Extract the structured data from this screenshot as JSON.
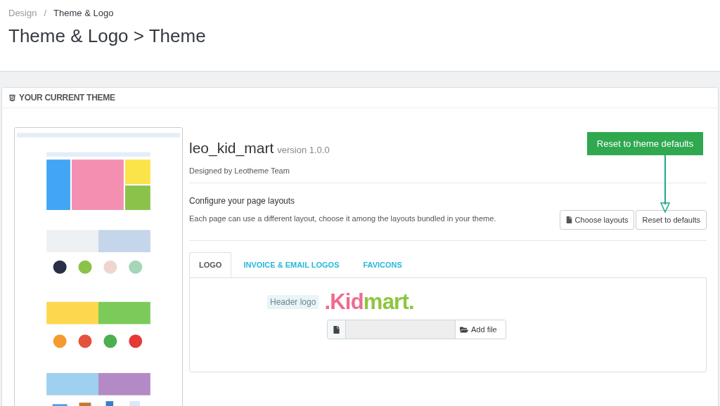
{
  "breadcrumb": [
    {
      "label": "Design",
      "current": false
    },
    {
      "label": "Theme & Logo",
      "current": true
    }
  ],
  "breadcrumb_separator": "/",
  "page_title": "Theme & Logo > Theme",
  "panel": {
    "title": "YOUR CURRENT THEME",
    "theme": {
      "name": "leo_kid_mart",
      "version": "version 1.0.0",
      "author": "Designed by Leotheme Team"
    },
    "layouts": {
      "heading": "Configure your page layouts",
      "description": "Each page can use a different layout, choose it among the layouts bundled in your theme.",
      "buttons": [
        {
          "label": "Choose layouts",
          "kind": "icon"
        },
        {
          "label": "Reset to defaults",
          "kind": "plain"
        }
      ]
    },
    "tabs": [
      {
        "label": "LOGO",
        "selected": true
      },
      {
        "label": "INVOICE & EMAIL LOGOS",
        "selected": false
      },
      {
        "label": "FAVICONS",
        "selected": false
      }
    ],
    "header_logo": {
      "label": "Header logo",
      "logo": [
        {
          "text": ".Kid",
          "color": "#ef6b8f"
        },
        {
          "text": "mart.",
          "color": "#8cc63f"
        }
      ],
      "add_file": "Add file"
    }
  },
  "annotation": {
    "text": "Reset to theme defaults"
  }
}
